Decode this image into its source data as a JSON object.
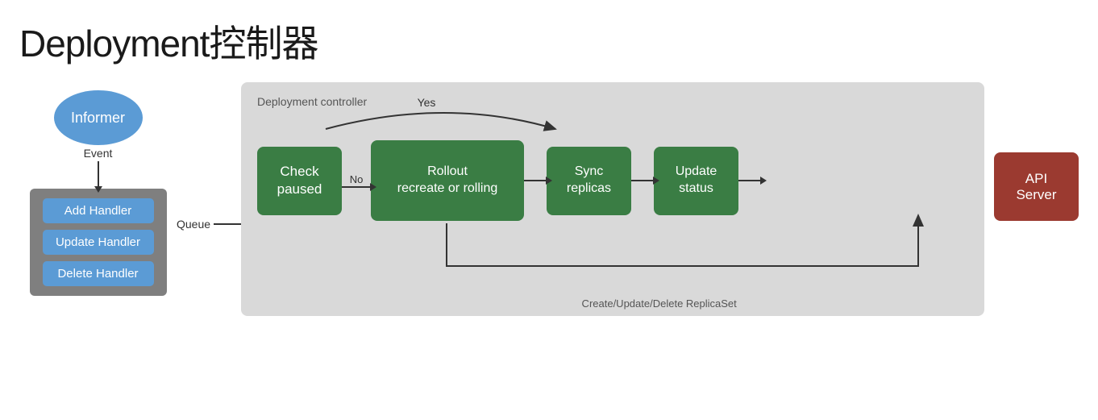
{
  "title": "Deployment控制器",
  "informer": {
    "label": "Informer"
  },
  "event_label": "Event",
  "queue_label": "Queue",
  "handler_box": {
    "handlers": [
      {
        "label": "Add Handler"
      },
      {
        "label": "Update Handler"
      },
      {
        "label": "Delete Handler"
      }
    ]
  },
  "deployment_controller": {
    "label": "Deployment controller",
    "steps": [
      {
        "id": "check-paused",
        "label": "Check\npaused"
      },
      {
        "id": "rollout",
        "label": "Rollout\nrecreate or rolling"
      },
      {
        "id": "sync-replicas",
        "label": "Sync\nreplicas"
      },
      {
        "id": "update-status",
        "label": "Update\nstatus"
      }
    ],
    "api_server": {
      "label": "API Server"
    },
    "arrow_no_label": "No",
    "arrow_yes_label": "Yes",
    "bottom_label": "Create/Update/Delete ReplicaSet"
  }
}
